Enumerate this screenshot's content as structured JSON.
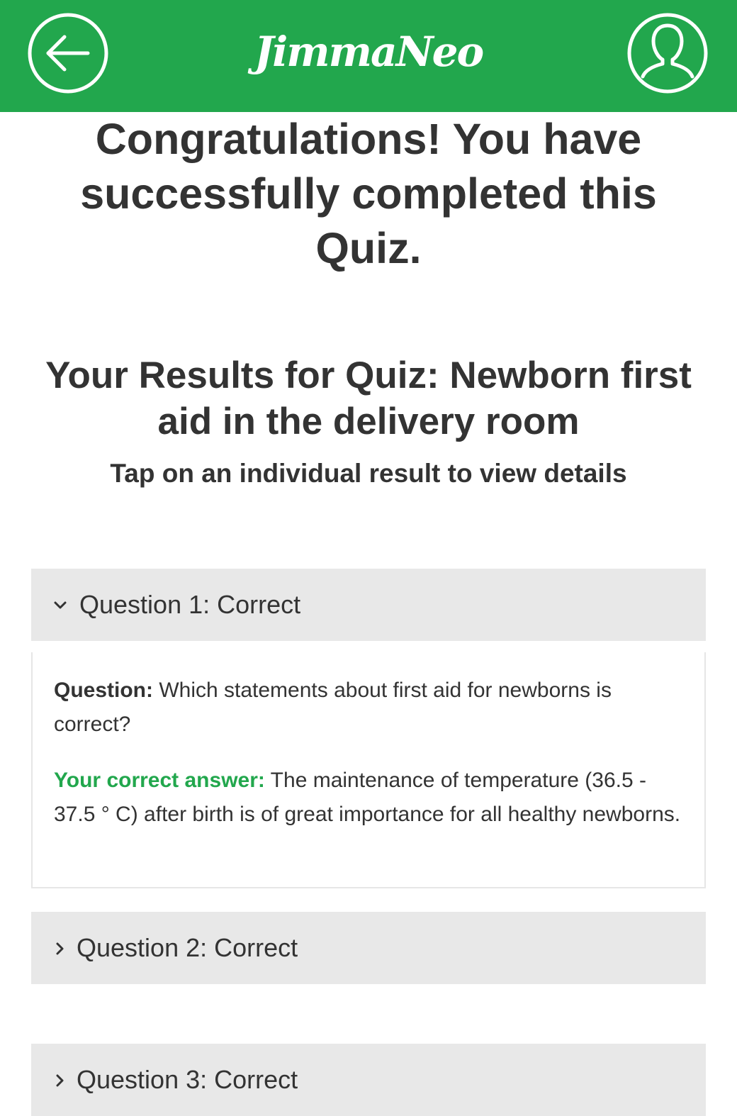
{
  "app": {
    "logo_text": "JimmaNeo",
    "header_color": "#22a74d",
    "back_icon": "arrow-left-circle-icon",
    "profile_icon": "user-circle-icon"
  },
  "congrats": {
    "text": "Congratulations! You have successfully completed this Quiz."
  },
  "results": {
    "title": "Your Results for Quiz: Newborn first aid in the delivery room",
    "subtitle": "Tap on an individual result to view details"
  },
  "questions": [
    {
      "label": "Question 1: Correct",
      "expanded": true,
      "question_label": "Question:",
      "question_text": " Which statements about first aid for newborns is correct?",
      "answer_label": "Your correct answer:",
      "answer_text": " The maintenance of temperature (36.5 - 37.5 ° C) after birth is of great importance for all healthy newborns."
    },
    {
      "label": "Question 2: Correct",
      "expanded": false
    },
    {
      "label": "Question 3: Correct",
      "expanded": false
    }
  ],
  "colors": {
    "accent": "#22a74d",
    "accordion_bg": "#e8e8e8",
    "text": "#333333"
  }
}
